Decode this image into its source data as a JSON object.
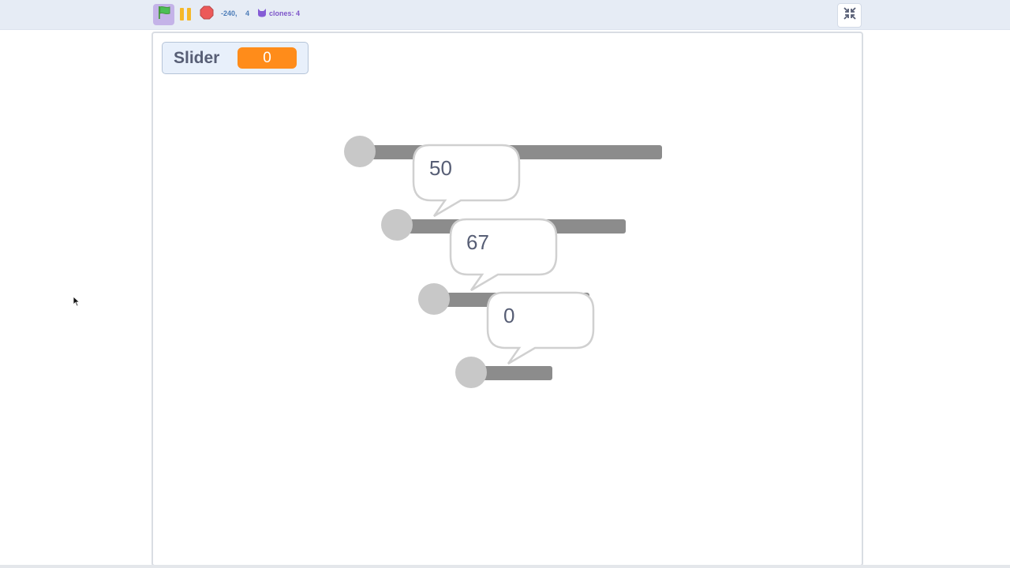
{
  "toolbar": {
    "green_flag_icon": "green-flag-icon",
    "pause_icon": "pause-icon",
    "stop_icon": "stop-sign-icon",
    "mouse_x": "-240,",
    "mouse_y": "4",
    "clones_icon": "cat-head-icon",
    "clones_label": "clones: 4",
    "fullscreen_icon": "exit-fullscreen-icon"
  },
  "monitor": {
    "label": "Slider",
    "value": "0"
  },
  "sprites": [
    {
      "bubble_text": "50"
    },
    {
      "bubble_text": "67"
    },
    {
      "bubble_text": "0"
    },
    {
      "bubble_text": ""
    }
  ],
  "colors": {
    "accent_orange": "#ff8c1a",
    "track_gray": "#8c8c8c",
    "knob_gray": "#c8c8c8",
    "flag_active_bg": "#c4b3e8",
    "text_slate": "#575e75"
  }
}
